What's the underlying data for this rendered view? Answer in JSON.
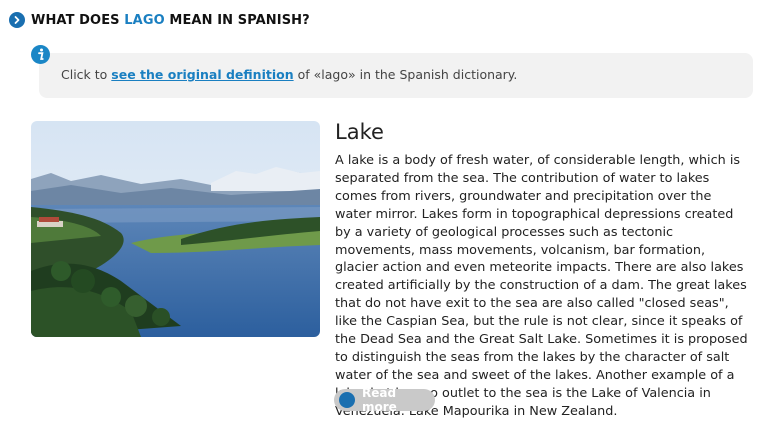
{
  "header": {
    "prefix": "WHAT DOES",
    "highlight": "LAGO",
    "suffix": "MEAN IN SPANISH?",
    "icon": "chevron-right-icon"
  },
  "info": {
    "icon": "info-icon",
    "text_before": "Click to",
    "link_text": "see the original definition",
    "text_after": "of «lago» in the Spanish dictionary."
  },
  "entry": {
    "title": "Lake",
    "body": "A lake is a body of fresh water, of considerable length, which is separated from the sea. The contribution of water to lakes comes from rivers, groundwater and precipitation over the water mirror. Lakes form in topographical depressions created by a variety of geological processes such as tectonic movements, mass movements, volcanism, bar formation, glacier action and even meteorite impacts. There are also lakes created artificially by the construction of a dam. The great lakes that do not have exit to the sea are also called \"closed seas\", like the Caspian Sea, but the rule is not clear, since it speaks of the Dead Sea and the Great Salt Lake. Sometimes it is proposed to distinguish the seas from the lakes by the character of salt water of the sea and sweet of the lakes. Another example of a lake that has no outlet to the sea is the Lake of Valencia in Venezuela. Lake Mapourika in New Zealand.",
    "read_more": "Read more"
  },
  "colors": {
    "accent": "#1a7fc1",
    "info_bg": "#f2f2f2"
  }
}
